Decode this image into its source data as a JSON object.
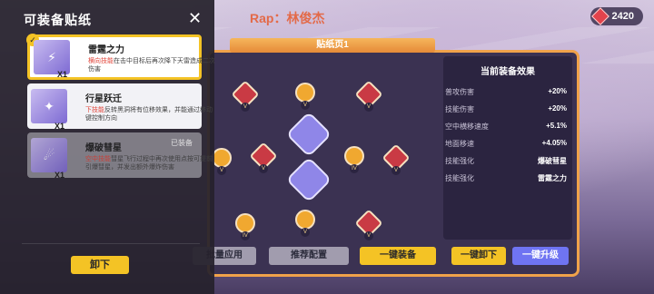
{
  "header": {
    "title": "Rap：林俊杰",
    "currency": "2420"
  },
  "left_panel": {
    "title": "可装备贴纸",
    "cards": [
      {
        "name": "雷霆之力",
        "count": "X1",
        "desc_hl": "横向技能",
        "desc": "在击中目标后再次降下天雷造成二次伤害",
        "state": "selected"
      },
      {
        "name": "行星跃迁",
        "count": "X1",
        "desc_hl": "下技能",
        "desc": "反转黑洞将有位移效果，并能通过移动键控制方向",
        "state": "normal"
      },
      {
        "name": "爆破彗星",
        "count": "X1",
        "desc_hl": "空中技能",
        "desc": "彗星飞行过程中再次使用点按可提前引爆彗星，并发出额外爆炸伤害",
        "state": "disabled",
        "tag": "已装备"
      }
    ],
    "unload_label": "卸下"
  },
  "board": {
    "page_label": "贴纸页1",
    "effects_title": "当前装备效果",
    "effects": [
      {
        "name": "普攻伤害",
        "value": "+20%"
      },
      {
        "name": "技能伤害",
        "value": "+20%"
      },
      {
        "name": "空中横移速度",
        "value": "+5.1%"
      },
      {
        "name": "地面移速",
        "value": "+4.05%"
      },
      {
        "name": "技能强化",
        "value": "爆破彗星"
      },
      {
        "name": "技能强化",
        "value": "雷霆之力"
      }
    ]
  },
  "buttons": {
    "apply": "批量应用",
    "recommend": "推荐配置",
    "equip_all": "一键装备",
    "unload_all": "一键卸下",
    "upgrade_all": "一键升级"
  },
  "badge_levels": {
    "v": "V",
    "iv": "IV"
  },
  "colors": {
    "accent": "#f4c325",
    "board_border": "#f0a24a",
    "highlight": "#e2463b"
  }
}
